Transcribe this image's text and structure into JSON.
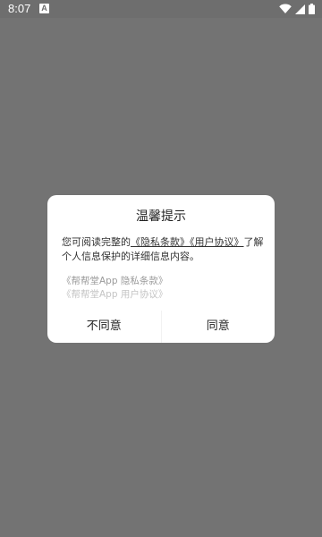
{
  "status_bar": {
    "time": "8:07",
    "notification_icon": "A",
    "icons": [
      "wifi-icon",
      "cell-signal-icon",
      "battery-icon"
    ]
  },
  "dialog": {
    "title": "温馨提示",
    "message_prefix": "您可阅读完整的",
    "privacy_link": "《隐私条款》",
    "user_agreement_link": "《用户协议》",
    "message_suffix": "了解个人信息保护的详细信息内容。",
    "doc_list": [
      "《帮帮堂App 隐私条款》",
      "《帮帮堂App 用户协议》"
    ],
    "decline_label": "不同意",
    "accept_label": "同意"
  }
}
